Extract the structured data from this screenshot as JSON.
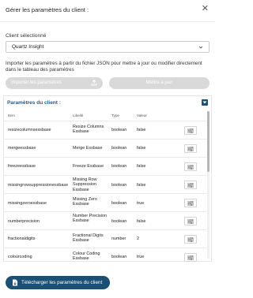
{
  "dialog": {
    "title": "Gérer les paramètres du client :",
    "close_glyph": "✕"
  },
  "client": {
    "label": "Client sélectionné",
    "selected": "Quartz Insight"
  },
  "import": {
    "description": "Importer les paramètres à partir du fichier JSON pour mettre à jour ou modifier directement dans le tableau des paramètres",
    "import_button": "Importer les paramètres",
    "update_button": "Mettre à jour"
  },
  "params": {
    "title": "Paramètres du client :",
    "columns": {
      "item": "Item",
      "libelle": "Libellé",
      "type": "Type",
      "valeur": "Valeur"
    },
    "rows": [
      {
        "item": "resizecolumnsessbase",
        "libelle": "Resize Columns Essbase",
        "type": "boolean",
        "valeur": "false"
      },
      {
        "item": "mergeessbase",
        "libelle": "Merge Essbase",
        "type": "boolean",
        "valeur": "false"
      },
      {
        "item": "freezeessbase",
        "libelle": "Freeze Essbase",
        "type": "boolean",
        "valeur": "false"
      },
      {
        "item": "missingrowsuppressionessbase",
        "libelle": "Missing Row Suppression Essbase",
        "type": "boolean",
        "valeur": "false"
      },
      {
        "item": "missingzeroessbase",
        "libelle": "Missing Zero Essbase",
        "type": "boolean",
        "valeur": "true"
      },
      {
        "item": "numberprecision",
        "libelle": "Number Precision Essbase",
        "type": "boolean",
        "valeur": "false"
      },
      {
        "item": "fractionaldigits",
        "libelle": "Fractional Digits Essbase",
        "type": "number",
        "valeur": "2"
      },
      {
        "item": "colourcoding",
        "libelle": "Colour Coding Essbase",
        "type": "boolean",
        "valeur": "true"
      }
    ]
  },
  "download": {
    "label": "Télécharger les paramètres du client"
  },
  "colors": {
    "primary": "#1b4f73",
    "title_blue": "#1f5b8c",
    "disabled": "#d9d9d9"
  },
  "icons": [
    "close-icon",
    "chevron-down-icon",
    "upload-icon",
    "collapse-icon",
    "sliders-icon",
    "file-download-icon"
  ]
}
